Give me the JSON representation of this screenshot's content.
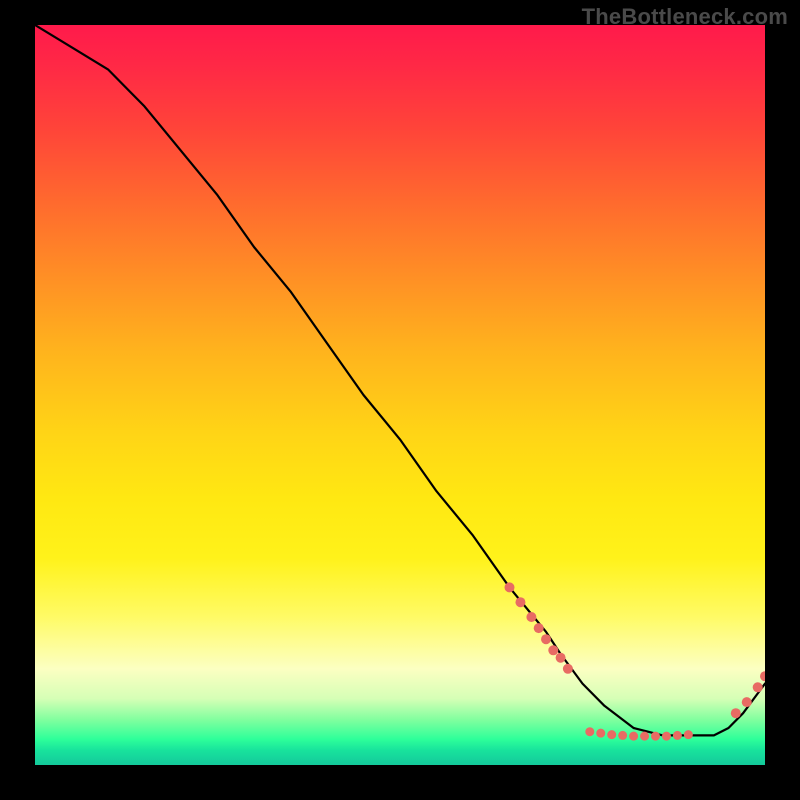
{
  "watermark": "TheBottleneck.com",
  "chart_data": {
    "type": "line",
    "title": "",
    "xlabel": "",
    "ylabel": "",
    "xlim": [
      0,
      100
    ],
    "ylim": [
      0,
      100
    ],
    "series": [
      {
        "name": "curve",
        "x": [
          0,
          5,
          10,
          15,
          20,
          25,
          30,
          35,
          40,
          45,
          50,
          55,
          60,
          65,
          70,
          72,
          75,
          78,
          82,
          86,
          90,
          93,
          95,
          97,
          100
        ],
        "y": [
          100,
          97,
          94,
          89,
          83,
          77,
          70,
          64,
          57,
          50,
          44,
          37,
          31,
          24,
          18,
          15,
          11,
          8,
          5,
          4,
          4,
          4,
          5,
          7,
          11
        ]
      }
    ],
    "markers_level1": {
      "name": "coral-markers-dense",
      "color": "#e86b63",
      "radius": 5,
      "points": [
        {
          "x": 65.0,
          "y": 24.0
        },
        {
          "x": 66.5,
          "y": 22.0
        },
        {
          "x": 68.0,
          "y": 20.0
        },
        {
          "x": 69.0,
          "y": 18.5
        },
        {
          "x": 70.0,
          "y": 17.0
        },
        {
          "x": 71.0,
          "y": 15.5
        },
        {
          "x": 72.0,
          "y": 14.5
        },
        {
          "x": 73.0,
          "y": 13.0
        }
      ]
    },
    "markers_level2": {
      "name": "coral-markers-bottom",
      "color": "#e86b63",
      "radius": 4.5,
      "points": [
        {
          "x": 76.0,
          "y": 4.5
        },
        {
          "x": 77.5,
          "y": 4.3
        },
        {
          "x": 79.0,
          "y": 4.1
        },
        {
          "x": 80.5,
          "y": 4.0
        },
        {
          "x": 82.0,
          "y": 3.9
        },
        {
          "x": 83.5,
          "y": 3.9
        },
        {
          "x": 85.0,
          "y": 3.9
        },
        {
          "x": 86.5,
          "y": 3.9
        },
        {
          "x": 88.0,
          "y": 4.0
        },
        {
          "x": 89.5,
          "y": 4.1
        }
      ]
    },
    "markers_level3": {
      "name": "coral-markers-rise",
      "color": "#e86b63",
      "radius": 5,
      "points": [
        {
          "x": 96.0,
          "y": 7.0
        },
        {
          "x": 97.5,
          "y": 8.5
        },
        {
          "x": 99.0,
          "y": 10.5
        },
        {
          "x": 100.0,
          "y": 12.0
        }
      ]
    }
  }
}
